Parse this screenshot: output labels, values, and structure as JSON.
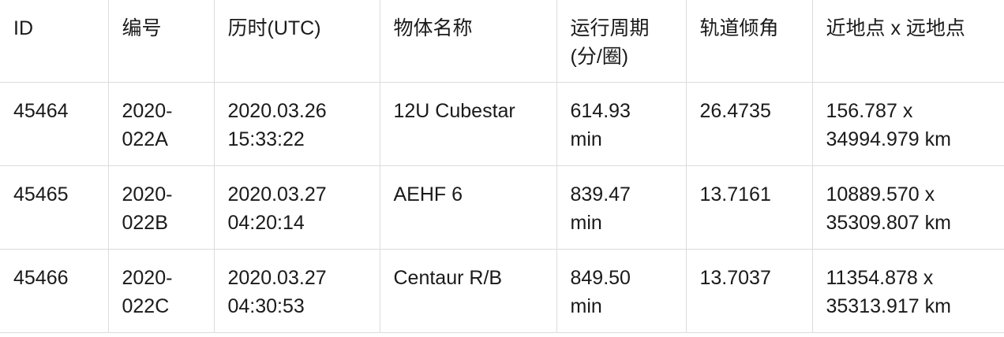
{
  "table": {
    "headers": [
      "ID",
      "编号",
      "历时(UTC)",
      "物体名称",
      "运行周期(分/圈)",
      "轨道倾角",
      "近地点 x 远地点"
    ],
    "rows": [
      {
        "id": "45464",
        "designation_line1": "2020-",
        "designation_line2": "022A",
        "epoch_line1": "2020.03.26",
        "epoch_line2": "15:33:22",
        "name": "12U Cubestar",
        "period_line1": "614.93",
        "period_line2": "min",
        "inclination": "26.4735",
        "orbit_line1": "156.787 x",
        "orbit_line2": "34994.979 km"
      },
      {
        "id": "45465",
        "designation_line1": "2020-",
        "designation_line2": "022B",
        "epoch_line1": "2020.03.27",
        "epoch_line2": "04:20:14",
        "name": "AEHF 6",
        "period_line1": "839.47",
        "period_line2": "min",
        "inclination": "13.7161",
        "orbit_line1": "10889.570 x",
        "orbit_line2": "35309.807 km"
      },
      {
        "id": "45466",
        "designation_line1": "2020-",
        "designation_line2": "022C",
        "epoch_line1": "2020.03.27",
        "epoch_line2": "04:30:53",
        "name": "Centaur R/B",
        "period_line1": "849.50",
        "period_line2": "min",
        "inclination": "13.7037",
        "orbit_line1": "11354.878 x",
        "orbit_line2": "35313.917 km"
      }
    ]
  }
}
